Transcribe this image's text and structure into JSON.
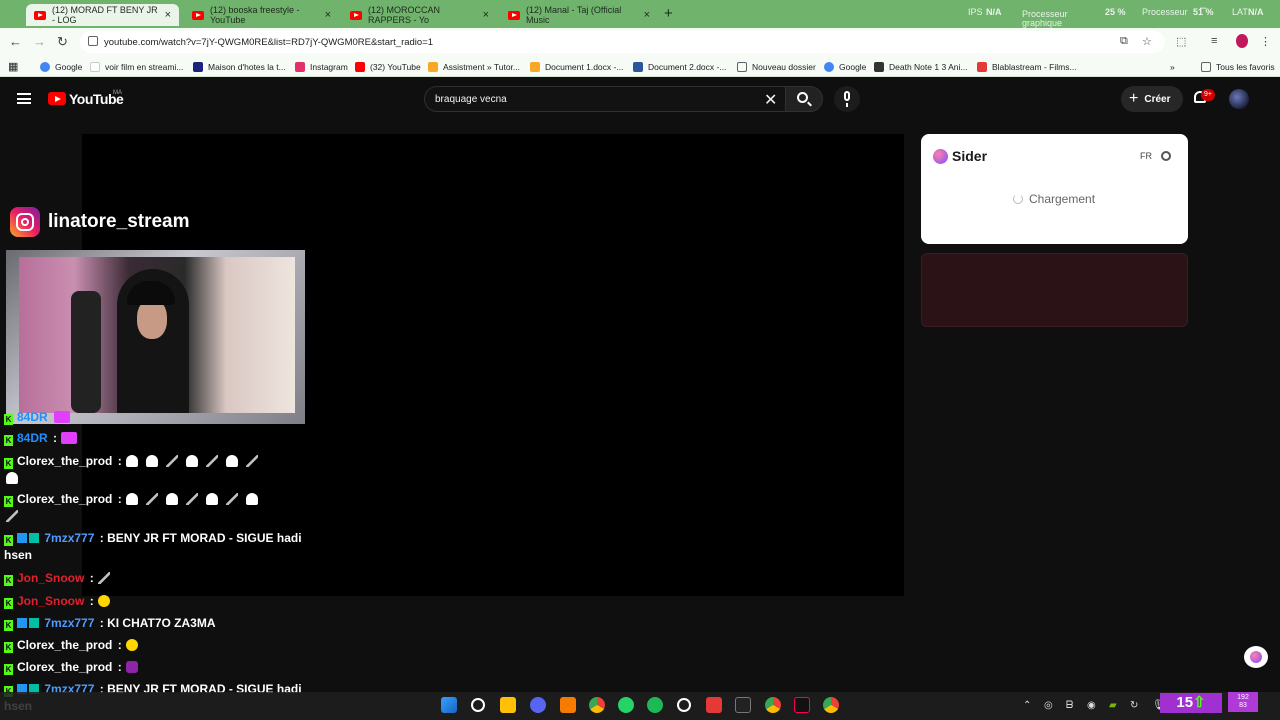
{
  "browser": {
    "tabs": [
      {
        "label": "(12) MORAD FT BENY JR - LOG",
        "active": true
      },
      {
        "label": "(12) booska freestyle - YouTube",
        "active": false
      },
      {
        "label": "(12) MOROCCAN RAPPERS - Yo",
        "active": false
      },
      {
        "label": "(12) Manal - Taj (Official Music",
        "active": false
      }
    ],
    "overlay": {
      "ips_label": "IPS",
      "ips_value": "N/A",
      "gpu_label": "Processeur graphique",
      "gpu_value": "25 %",
      "cpu_label": "Processeur",
      "cpu_value": "51 %",
      "lat_label": "LAT",
      "lat_value": "N/A"
    },
    "url": "youtube.com/watch?v=7jY-QWGM0RE&list=RD7jY-QWGM0RE&start_radio=1",
    "bookmarks": [
      {
        "label": "Google",
        "color": "#4285f4"
      },
      {
        "label": "voir film en streami...",
        "color": "#ffffff"
      },
      {
        "label": "Maison d'hotes la t...",
        "color": "#1a237e"
      },
      {
        "label": "Instagram",
        "color": "#e1306c"
      },
      {
        "label": "(32) YouTube",
        "color": "#ff0000"
      },
      {
        "label": "Assistment » Tutor...",
        "color": "#f9a825"
      },
      {
        "label": "Document 1.docx -...",
        "color": "#f9a825"
      },
      {
        "label": "Document 2.docx -...",
        "color": "#2b579a"
      },
      {
        "label": "Nouveau dossier",
        "color": "#5f6368"
      },
      {
        "label": "Google",
        "color": "#4285f4"
      },
      {
        "label": "Death Note 1 3 Ani...",
        "color": "#333333"
      },
      {
        "label": "Blablastream - Films...",
        "color": "#e53935"
      }
    ],
    "bookmarks_all": "Tous les favoris"
  },
  "youtube": {
    "logo_text": "YouTube",
    "region": "MA",
    "search_query": "braquage vecna",
    "create_label": "Créer",
    "notif_badge": "9+"
  },
  "stream": {
    "instagram_handle": "linatore_stream",
    "chat": [
      {
        "user": "84DR",
        "text": "",
        "color": "#1e90ff"
      },
      {
        "user": "84DR",
        "text": ":",
        "color": "#1e90ff"
      },
      {
        "user": "Clorex_the_prod",
        "text": ":",
        "color": "#ffffff"
      },
      {
        "user": "Clorex_the_prod",
        "text": ":",
        "color": "#ffffff"
      },
      {
        "user": "7mzx777",
        "text": ": BENY JR FT MORAD - SIGUE hadi",
        "cont": "hsen",
        "color": "#4f9cff"
      },
      {
        "user": "Jon_Snoow",
        "text": ":",
        "color": "#e0202d"
      },
      {
        "user": "Jon_Snoow",
        "text": ":",
        "color": "#e0202d"
      },
      {
        "user": "7mzx777",
        "text": ": KI CHAT7O ZA3MA",
        "color": "#4f9cff"
      },
      {
        "user": "Clorex_the_prod",
        "text": ":",
        "color": "#ffffff"
      },
      {
        "user": "Clorex_the_prod",
        "text": ":",
        "color": "#ffffff"
      },
      {
        "user": "7mzx777",
        "text": ": BENY JR FT MORAD - SIGUE hadi",
        "cont": "hsen",
        "color": "#4f9cff"
      }
    ]
  },
  "sider": {
    "title": "Sider",
    "lang": "FR",
    "loading": "Chargement"
  },
  "taskbar": {
    "kick_count": "15",
    "clock_top": "192",
    "clock_bottom": "83"
  }
}
